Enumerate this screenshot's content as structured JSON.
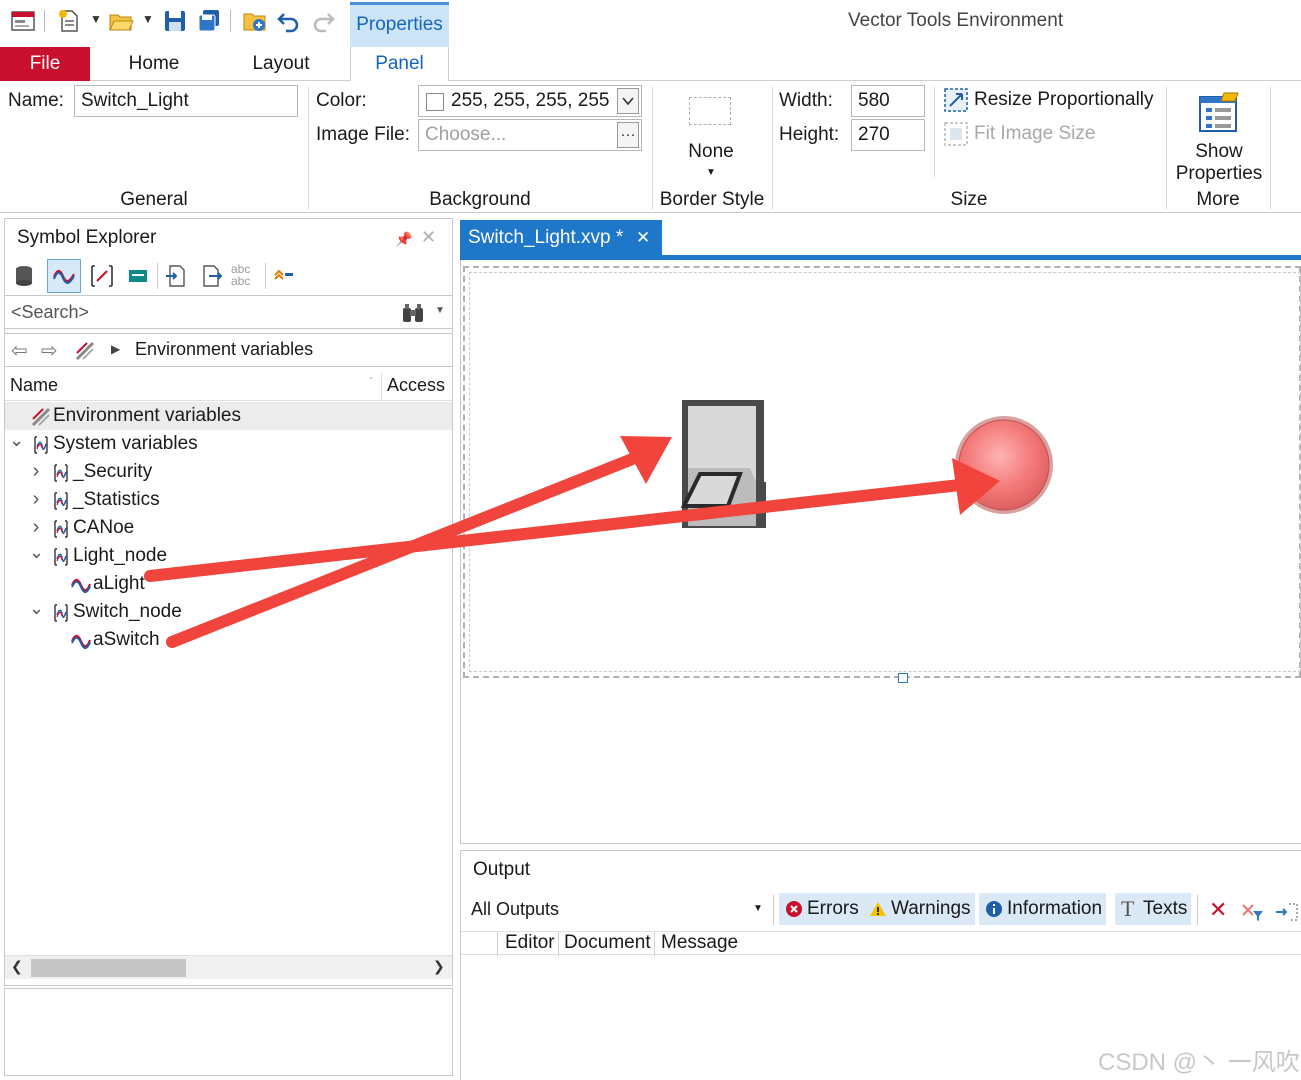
{
  "window": {
    "title": "Vector Tools Environment"
  },
  "quick_access": {
    "icons": [
      "panel-icon",
      "new-icon",
      "open-icon",
      "save-icon",
      "save-all-icon",
      "open-folder-icon",
      "undo-icon",
      "redo-icon"
    ]
  },
  "ribbon": {
    "context_tab": "Properties",
    "tabs": [
      "File",
      "Home",
      "Layout",
      "Panel"
    ],
    "general": {
      "group_label": "General",
      "name_label": "Name:",
      "name_value": "Switch_Light"
    },
    "background": {
      "group_label": "Background",
      "color_label": "Color:",
      "color_value": "255, 255, 255, 255",
      "image_label": "Image File:",
      "image_placeholder": "Choose..."
    },
    "border": {
      "group_label": "Border Style",
      "value": "None"
    },
    "size": {
      "group_label": "Size",
      "width_label": "Width:",
      "width_value": "580",
      "height_label": "Height:",
      "height_value": "270",
      "resize_label": "Resize Proportionally",
      "fit_label": "Fit Image Size"
    },
    "more": {
      "group_label": "More",
      "show_props_line1": "Show",
      "show_props_line2": "Properties"
    }
  },
  "symbol_explorer": {
    "title": "Symbol Explorer",
    "search_placeholder": "<Search>",
    "breadcrumb": "Environment variables",
    "columns": [
      "Name",
      "Access"
    ],
    "tree": [
      {
        "label": "Environment variables",
        "level": 0,
        "icon": "env-variables-icon",
        "expander": "",
        "selected": true
      },
      {
        "label": "System variables",
        "level": 0,
        "icon": "sysvar-namespace-icon",
        "expander": "open"
      },
      {
        "label": "_Security",
        "level": 1,
        "icon": "sysvar-namespace-icon",
        "expander": "closed"
      },
      {
        "label": "_Statistics",
        "level": 1,
        "icon": "sysvar-namespace-icon",
        "expander": "closed"
      },
      {
        "label": "CANoe",
        "level": 1,
        "icon": "sysvar-namespace-icon",
        "expander": "closed"
      },
      {
        "label": "Light_node",
        "level": 1,
        "icon": "sysvar-namespace-icon",
        "expander": "open"
      },
      {
        "label": "aLight",
        "level": 2,
        "icon": "variable-wave-icon",
        "expander": ""
      },
      {
        "label": "Switch_node",
        "level": 1,
        "icon": "sysvar-namespace-icon",
        "expander": "open"
      },
      {
        "label": "aSwitch",
        "level": 2,
        "icon": "variable-wave-icon",
        "expander": ""
      }
    ]
  },
  "document": {
    "tab_label": "Switch_Light.xvp *",
    "close_glyph": "✕"
  },
  "output": {
    "title": "Output",
    "filter_value": "All Outputs",
    "filters": {
      "errors": "Errors",
      "warnings": "Warnings",
      "information": "Information",
      "texts": "Texts"
    },
    "columns": [
      "Editor",
      "Document",
      "Message"
    ]
  },
  "colors": {
    "file_tab": "#c8102e",
    "accent": "#1f77c9",
    "arrow": "#f0443d",
    "lamp": "#f47a7a"
  },
  "watermark": "CSDN @丶 一风吹"
}
